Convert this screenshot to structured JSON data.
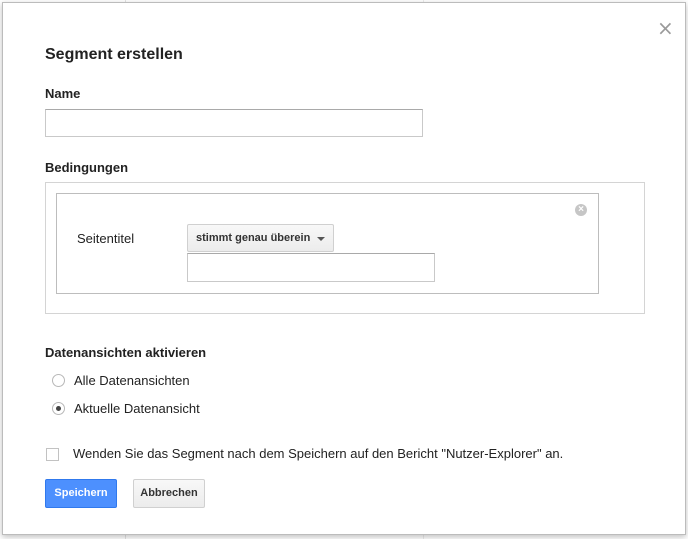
{
  "dialog": {
    "title": "Segment erstellen",
    "close_icon": "close-icon",
    "name_label": "Name",
    "name_value": "",
    "conditions_label": "Bedingungen",
    "condition": {
      "field": "Seitentitel",
      "operator": "stimmt genau überein",
      "value": "",
      "remove_icon": "remove-circle-icon"
    },
    "views_label": "Datenansichten aktivieren",
    "view_options": [
      {
        "label": "Alle Datenansichten",
        "checked": false
      },
      {
        "label": "Aktuelle Datenansicht",
        "checked": true
      }
    ],
    "apply_checkbox_label": "Wenden Sie das Segment nach dem Speichern auf den Bericht \"Nutzer-Explorer\" an.",
    "apply_checked": false,
    "save_label": "Speichern",
    "cancel_label": "Abbrechen",
    "primary_color": "#4d90fe"
  }
}
